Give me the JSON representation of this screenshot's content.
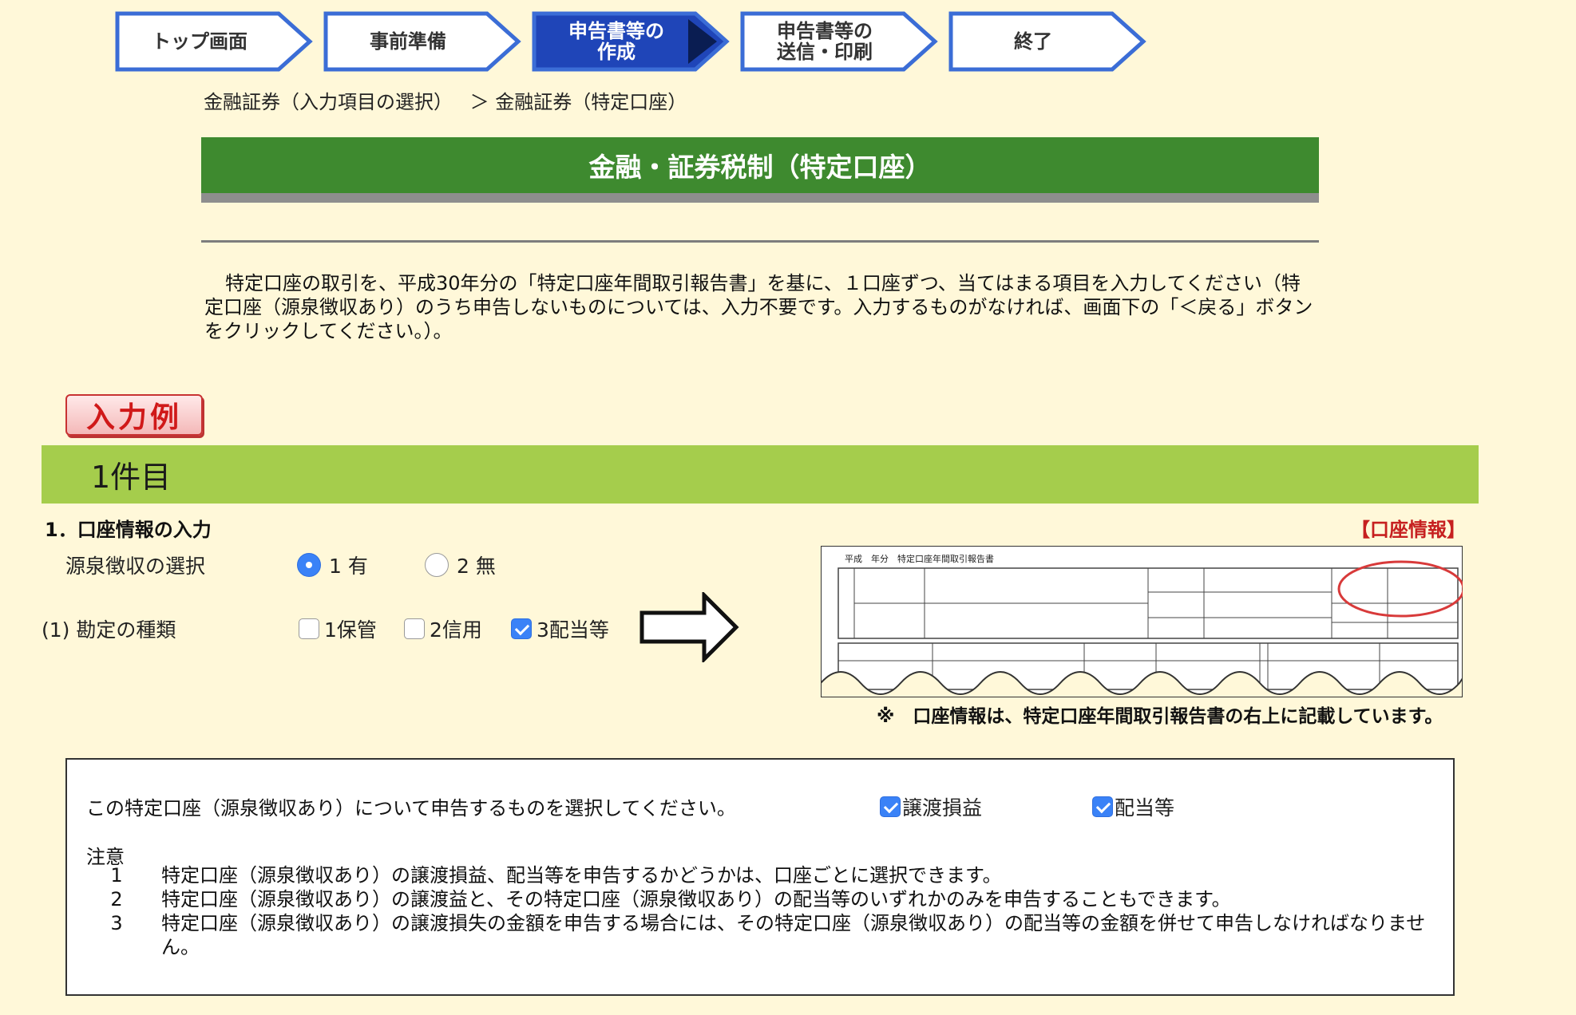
{
  "steps": [
    {
      "label": "トップ画面",
      "active": false
    },
    {
      "label": "事前準備",
      "active": false
    },
    {
      "label": "申告書等の\n作成",
      "active": true
    },
    {
      "label": "申告書等の\n送信・印刷",
      "active": false
    },
    {
      "label": "終了",
      "active": false
    }
  ],
  "breadcrumb": {
    "items": [
      "金融証券（入力項目の選択）",
      "＞ 金融証券（特定口座）"
    ]
  },
  "page_title": "金融・証券税制（特定口座）",
  "intro": "特定口座の取引を、平成30年分の「特定口座年間取引報告書」を基に、１口座ずつ、当てはまる項目を入力してください（特定口座（源泉徴収あり）のうち申告しないものについては、入力不要です。入力するものがなければ、画面下の「＜戻る」ボタンをクリックしてください。）。",
  "example_button": "入力例",
  "item_header": "1件目",
  "account_section": {
    "title": "1．口座情報の入力",
    "link": "【口座情報】",
    "withholding": {
      "label": "源泉徴収の選択",
      "options": [
        {
          "label": "1 有",
          "checked": true
        },
        {
          "label": "2 無",
          "checked": false
        }
      ]
    },
    "account_type": {
      "label": "(1) 勘定の種類",
      "options": [
        {
          "label": "1保管",
          "checked": false
        },
        {
          "label": "2信用",
          "checked": false
        },
        {
          "label": "3配当等",
          "checked": true
        }
      ]
    },
    "form_image": {
      "header": "平成　年分　特定口座年間取引報告書",
      "note": "※　口座情報は、特定口座年間取引報告書の右上に記載しています。"
    }
  },
  "declaration": {
    "question": "この特定口座（源泉徴収あり）について申告するものを選択してください。",
    "options": [
      {
        "label": "譲渡損益",
        "checked": true
      },
      {
        "label": "配当等",
        "checked": true
      }
    ],
    "notes_heading": "注意",
    "notes": [
      {
        "num": "1",
        "text": "特定口座（源泉徴収あり）の譲渡損益、配当等を申告するかどうかは、口座ごとに選択できます。"
      },
      {
        "num": "2",
        "text": "特定口座（源泉徴収あり）の譲渡益と、その特定口座（源泉徴収あり）の配当等のいずれかのみを申告することもできます。"
      },
      {
        "num": "3",
        "text": "特定口座（源泉徴収あり）の譲渡損失の金額を申告する場合には、その特定口座（源泉徴収あり）の配当等の金額を併せて申告しなければなりません。"
      }
    ]
  },
  "colors": {
    "page_bg": "#fff8d9",
    "title_green": "#3e8a2f",
    "item_green": "#a5cd4c",
    "step_active": "#1f45b8",
    "link_red": "#c62020",
    "checkbox_blue": "#3a82f7"
  }
}
